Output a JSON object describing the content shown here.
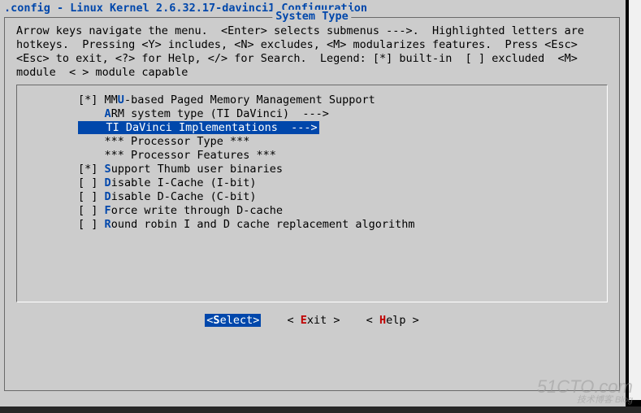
{
  "title": ".config - Linux Kernel 2.6.32.17-davinci1 Configuration",
  "frame_title": "System Type",
  "help_text": "Arrow keys navigate the menu.  <Enter> selects submenus --->.  Highlighted letters are hotkeys.  Pressing <Y> includes, <N> excludes, <M> modularizes features.  Press <Esc><Esc> to exit, <?> for Help, </> for Search.  Legend: [*] built-in  [ ] excluded  <M> module  < > module capable",
  "items": [
    {
      "prefix": "        [*] MM",
      "hot": "U",
      "rest": "-based Paged Memory Management Support",
      "selected": false
    },
    {
      "prefix": "            ",
      "hot": "A",
      "rest": "RM system type (TI DaVinci)  --->",
      "selected": false
    },
    {
      "prefix": "        ",
      "hot": "T",
      "rest": "I DaVinci Implementations  --->",
      "selected": true,
      "seltext": "    TI DaVinci Implementations  --->"
    },
    {
      "prefix": "            *** Processor Type ***",
      "hot": "",
      "rest": "",
      "selected": false
    },
    {
      "prefix": "            *** Processor Features ***",
      "hot": "",
      "rest": "",
      "selected": false
    },
    {
      "prefix": "        [*] ",
      "hot": "S",
      "rest": "upport Thumb user binaries",
      "selected": false
    },
    {
      "prefix": "        [ ] ",
      "hot": "D",
      "rest": "isable I-Cache (I-bit)",
      "selected": false
    },
    {
      "prefix": "        [ ] ",
      "hot": "D",
      "rest": "isable D-Cache (C-bit)",
      "selected": false
    },
    {
      "prefix": "        [ ] ",
      "hot": "F",
      "rest": "orce write through D-cache",
      "selected": false
    },
    {
      "prefix": "        [ ] ",
      "hot": "R",
      "rest": "ound robin I and D cache replacement algorithm",
      "selected": false
    }
  ],
  "buttons": {
    "select": {
      "open": "<",
      "hot": "S",
      "rest": "elect>",
      "selected": true
    },
    "exit": {
      "open": "< ",
      "hot": "E",
      "rest": "xit >",
      "selected": false
    },
    "help": {
      "open": "< ",
      "hot": "H",
      "rest": "elp >",
      "selected": false
    }
  },
  "watermark": {
    "main": "51CTO.com",
    "sub": "技术博客    Blog"
  }
}
